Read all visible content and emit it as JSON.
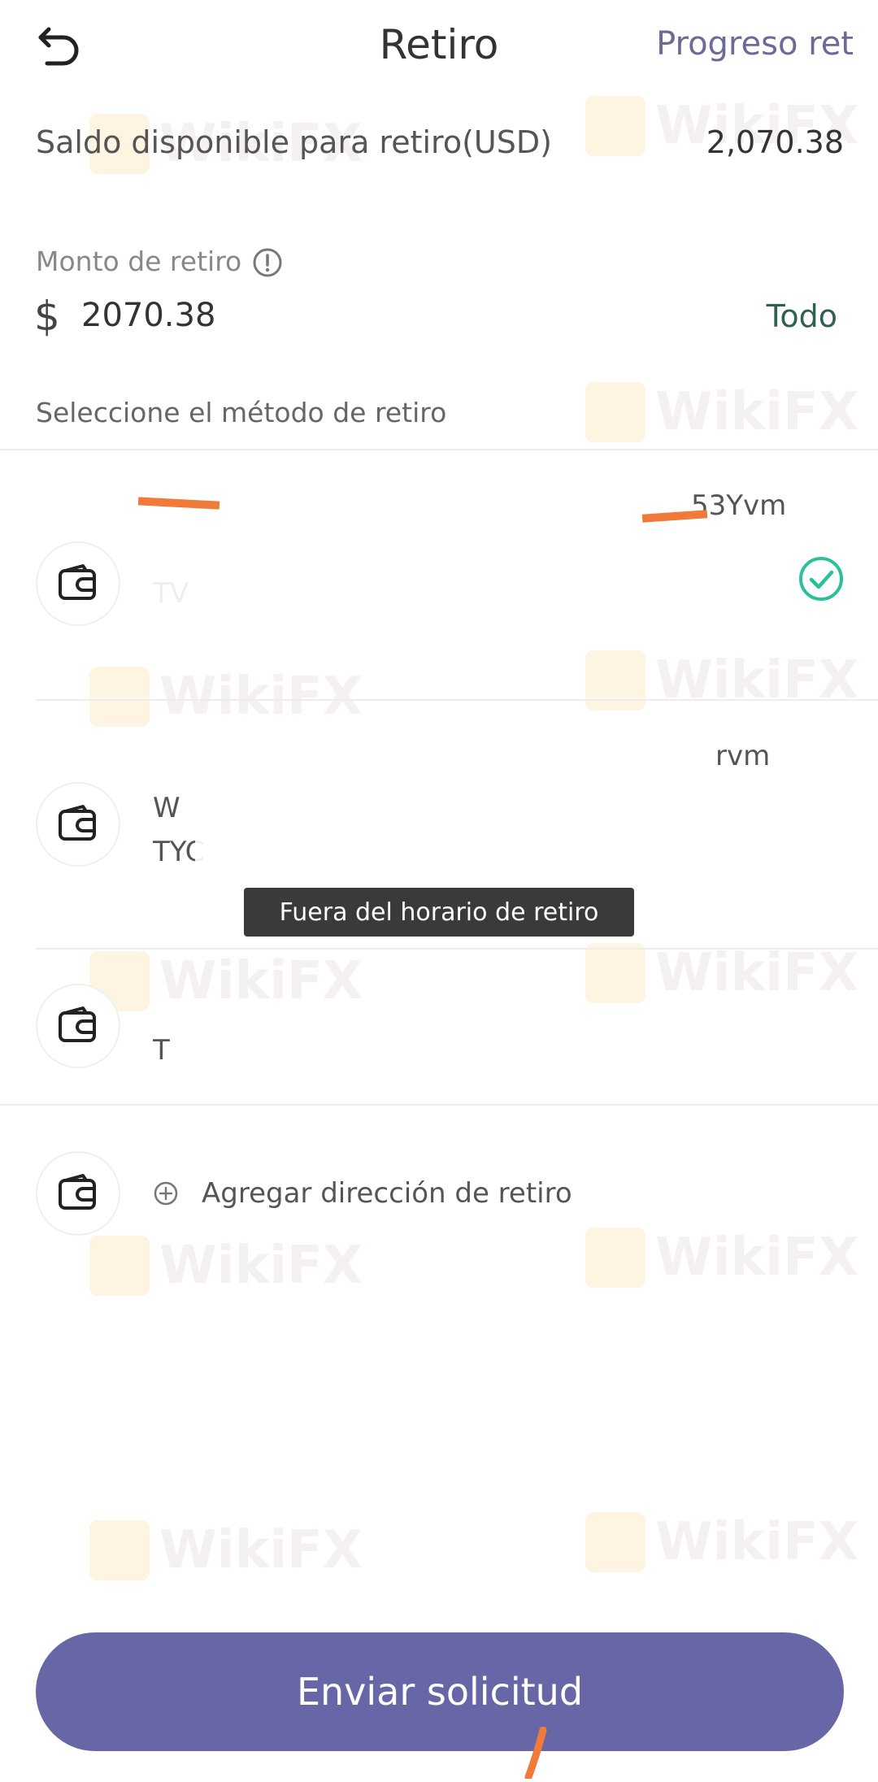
{
  "header": {
    "title": "Retiro",
    "progress_link": "Progreso ret"
  },
  "balance": {
    "label": "Saldo disponible para retiro(USD)",
    "value": "2,070.38"
  },
  "amount": {
    "label": "Monto de retiro",
    "currency_symbol": "$",
    "value": "2070.38",
    "all_label": "Todo"
  },
  "method_section": {
    "label": "Seleccione el método de retiro"
  },
  "methods": [
    {
      "line1": "53Yvm",
      "line2": "TV",
      "selected": true,
      "icon": "wallet-icon"
    },
    {
      "line1": "rvm",
      "line2": "W",
      "line3": "TYC",
      "status": "Fuera del horario de retiro",
      "selected": false,
      "icon": "wallet-icon"
    },
    {
      "line1": "T",
      "selected": false,
      "icon": "wallet-icon"
    }
  ],
  "add_address": {
    "label": "Agregar dirección de retiro",
    "icon": "plus-circle-icon"
  },
  "submit": {
    "label": "Enviar solicitud"
  },
  "watermark": "WikiFX",
  "colors": {
    "accent": "#6767a7",
    "link": "#2f5f55",
    "check": "#2bbf9a"
  }
}
